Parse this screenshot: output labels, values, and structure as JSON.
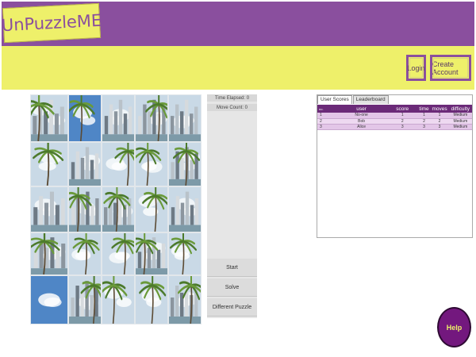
{
  "header": {
    "logo_text": "UnPuzzleME",
    "login_label": "Login",
    "create_account_label": "Create Account"
  },
  "game": {
    "time_elapsed": "Time Elapsed: 0",
    "move_count": "Move Count: 0",
    "start_label": "Start",
    "solve_label": "Solve",
    "different_label": "Different Puzzle"
  },
  "scores": {
    "tabs": [
      "User Scores",
      "Leaderboard"
    ],
    "columns": [
      "no.",
      "user",
      "score",
      "time",
      "moves",
      "difficulty"
    ],
    "rows": [
      [
        "1",
        "No-one",
        "1",
        "1",
        "1",
        "Medium"
      ],
      [
        "2",
        "Bob",
        "2",
        "2",
        "2",
        "Medium"
      ],
      [
        "3",
        "Alice",
        "3",
        "3",
        "3",
        "Medium"
      ]
    ]
  },
  "help_label": "Help",
  "colors": {
    "purple": "#8a4f9e",
    "yellow": "#eef06a",
    "table_header": "#6b2a78",
    "help_button": "#73187e"
  },
  "puzzle_tile_icons": [
    "palm-tile",
    "sky-tile",
    "city-tile",
    "city-tile",
    "city-tile",
    "palm-tile",
    "city-tile",
    "palm-tile",
    "palm-tile",
    "palm-tile",
    "city-tile",
    "city-tile",
    "palm-tile",
    "palm-tile",
    "city-tile",
    "palm-tile",
    "palm-tile",
    "palm-tile",
    "palm-tile",
    "palm-tile",
    "sky-tile",
    "city-tile",
    "palm-tile",
    "palm-tile",
    "palm-tile"
  ]
}
